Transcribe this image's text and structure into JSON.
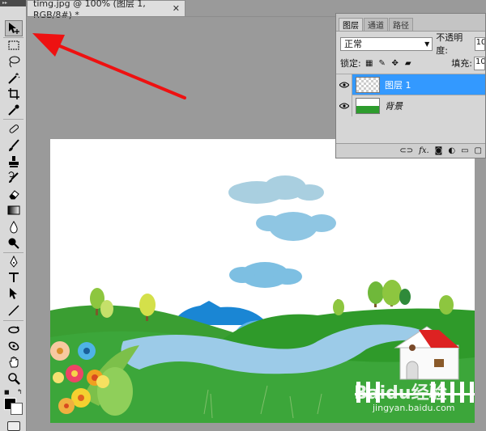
{
  "document": {
    "tab_title": "timg.jpg @ 100% (图层 1, RGB/8#) *",
    "close_glyph": "✕"
  },
  "toolbar": {
    "tools": [
      "move-tool",
      "marquee-tool",
      "lasso-tool",
      "magic-wand-tool",
      "crop-tool",
      "eyedropper-tool",
      "healing-brush-tool",
      "brush-tool",
      "clone-stamp-tool",
      "history-brush-tool",
      "eraser-tool",
      "gradient-tool",
      "blur-tool",
      "dodge-tool",
      "pen-tool",
      "type-tool",
      "path-selection-tool",
      "line-tool",
      "3d-rotate-tool",
      "3d-orbit-tool",
      "hand-tool",
      "zoom-tool"
    ],
    "active_tool": "move-tool"
  },
  "layers_panel": {
    "tabs": [
      "图层",
      "通道",
      "路径"
    ],
    "active_tab": "图层",
    "blend_mode": "正常",
    "opacity_label": "不透明度:",
    "opacity_value": "10",
    "lock_label": "锁定:",
    "fill_label": "填充:",
    "fill_value": "10",
    "layers": [
      {
        "name": "图层 1",
        "selected": true
      },
      {
        "name": "背景",
        "selected": false
      }
    ],
    "footer_icons": [
      "link-icon",
      "fx-icon",
      "mask-icon",
      "adjustment-icon",
      "group-icon",
      "new-layer-icon"
    ],
    "footer_fx": "fx."
  },
  "watermark": {
    "brand": "Baidu经验",
    "url": "jingyan.baidu.com"
  },
  "colors": {
    "selection_blue": "#3399ff",
    "arrow_red": "#ee1111",
    "grass_green": "#2e9c2e",
    "sky_cloud": "#8cc6e0",
    "river": "#9cc9e6",
    "roof_red": "#dd2222"
  }
}
